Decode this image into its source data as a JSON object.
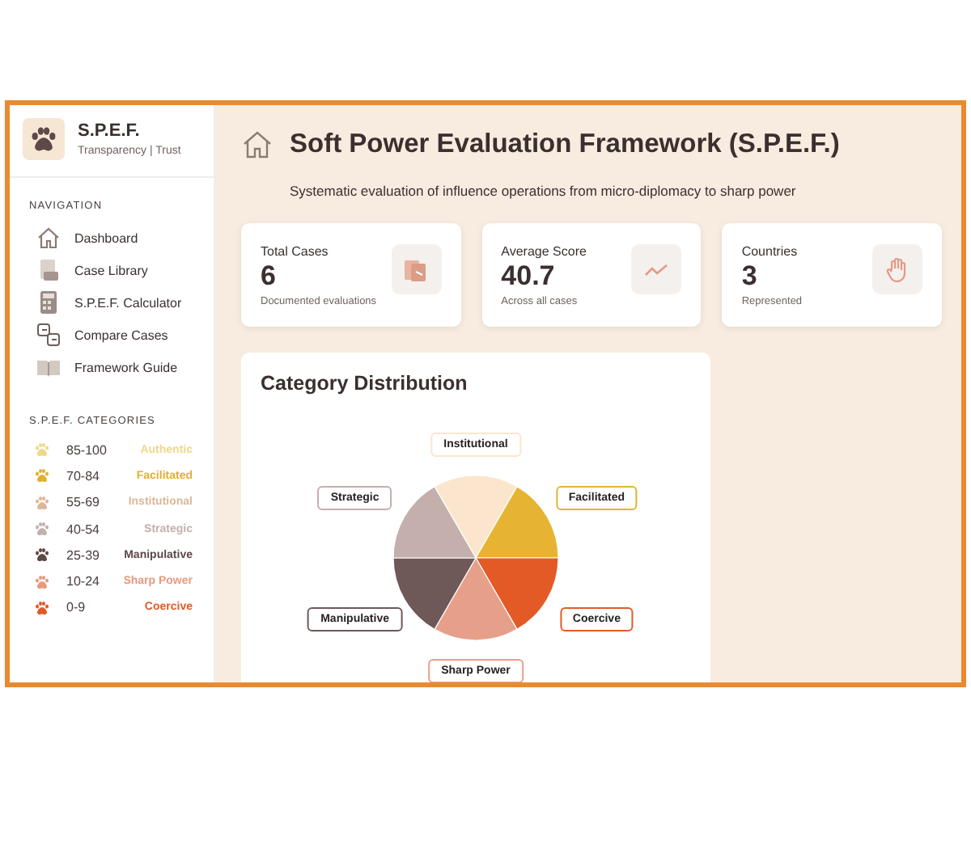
{
  "brand": {
    "title": "S.P.E.F.",
    "subtitle": "Transparency | Trust"
  },
  "navigation": {
    "heading": "NAVIGATION",
    "items": [
      {
        "label": "Dashboard",
        "kind": "home"
      },
      {
        "label": "Case Library",
        "kind": "library"
      },
      {
        "label": "S.P.E.F. Calculator",
        "kind": "calculator"
      },
      {
        "label": "Compare Cases",
        "kind": "compare"
      },
      {
        "label": "Framework Guide",
        "kind": "guide"
      }
    ]
  },
  "categories": {
    "heading": "S.P.E.F. CATEGORIES",
    "items": [
      {
        "range": "85-100",
        "name": "Authentic",
        "color": "#f0d88a"
      },
      {
        "range": "70-84",
        "name": "Facilitated",
        "color": "#e3b02e"
      },
      {
        "range": "55-69",
        "name": "Institutional",
        "color": "#dcb89a"
      },
      {
        "range": "40-54",
        "name": "Strategic",
        "color": "#c3b1ae"
      },
      {
        "range": "25-39",
        "name": "Manipulative",
        "color": "#5e4848"
      },
      {
        "range": "10-24",
        "name": "Sharp Power",
        "color": "#e89a7e"
      },
      {
        "range": "0-9",
        "name": "Coercive",
        "color": "#e05a26"
      }
    ]
  },
  "header": {
    "title": "Soft Power Evaluation Framework (S.P.E.F.)",
    "subtitle": "Systematic evaluation of influence operations from micro-diplomacy to sharp power"
  },
  "stats": [
    {
      "label": "Total Cases",
      "value": "6",
      "note": "Documented evaluations",
      "kind": "documents"
    },
    {
      "label": "Average Score",
      "value": "40.7",
      "note": "Across all cases",
      "kind": "trend"
    },
    {
      "label": "Countries",
      "value": "3",
      "note": "Represented",
      "kind": "hand"
    }
  ],
  "distribution": {
    "title": "Category Distribution",
    "slices": [
      {
        "label": "Institutional",
        "color": "#fbe6cd"
      },
      {
        "label": "Facilitated",
        "color": "#e6b432"
      },
      {
        "label": "Coercive",
        "color": "#e35a27"
      },
      {
        "label": "Sharp Power",
        "color": "#e6a08a"
      },
      {
        "label": "Manipulative",
        "color": "#6e5858"
      },
      {
        "label": "Strategic",
        "color": "#c4afac"
      }
    ]
  }
}
